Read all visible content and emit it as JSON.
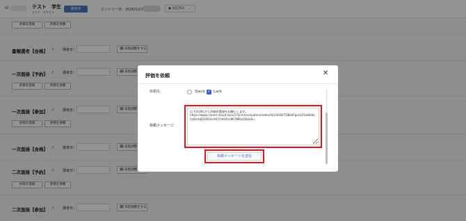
{
  "header": {
    "id_label": "ID :",
    "name": "テスト　学生",
    "kana": "テスト　ガクセイ",
    "status": "選考中",
    "entry_date": "エントリー日：2026/1/22",
    "response_select": "● 対応済み　⌄"
  },
  "buttons": {
    "evaluate": "評価を登録",
    "request": "評価を依頼",
    "schedule": "🗓 日程調整をする"
  },
  "stages": {
    "s0": {
      "title": "書類選考【合格】",
      "date_label": "選考日："
    },
    "s1": {
      "title": "一次面接【予約】",
      "date_label": "選考日："
    },
    "s2": {
      "title": "一次面接【参加】",
      "date_label": "選考日："
    },
    "s3": {
      "title": "一次面接【合格】",
      "date_label": "選考日："
    },
    "s4": {
      "title": "二次面接【予約】",
      "date_label": "選考日："
    },
    "s5": {
      "title": "二次面接【参加】",
      "date_label": "選考日："
    }
  },
  "modal": {
    "title": "評価を依頼",
    "close": "✕",
    "destination_label": "依頼先",
    "options": {
      "slack": "Slack",
      "lark": "Lark"
    },
    "lark_checked": true,
    "message_label": "依頼メッセージ",
    "message": "以下のURLから評価の登録をお願いします。\nhttps://www.career-cloud.asia/27/jcm/evaluation/index/VjUzSVBrTDBzdFgvckZUaWdlaFpIRmtJRGRHSmRCYnlHVUxMC9Mbz2Ddu0=",
    "send_button": "依頼メッセージを送信"
  },
  "colors": {
    "accent": "#3d63c9",
    "highlight": "#e0141a",
    "status_pill": "#4a78c2"
  }
}
